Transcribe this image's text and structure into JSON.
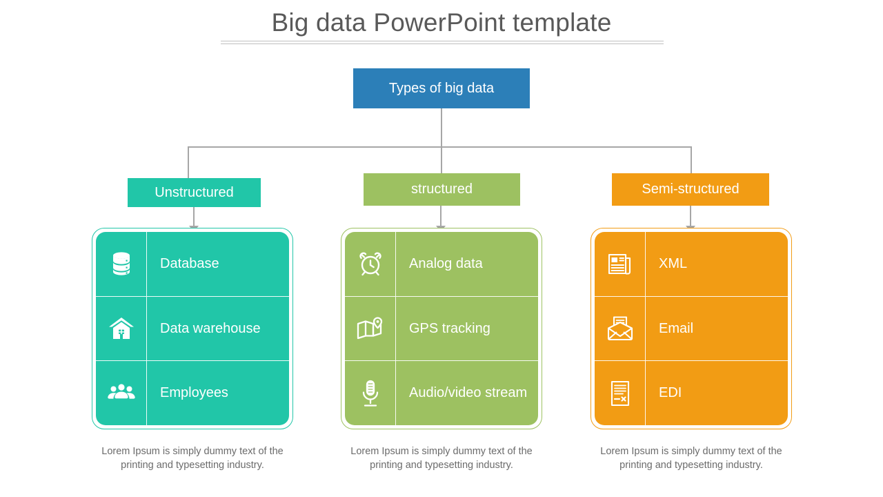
{
  "slide": {
    "title": "Big data PowerPoint template",
    "colors": {
      "blue": "#2C7FB8",
      "teal": "#21C6A8",
      "green": "#9DC161",
      "orange": "#F29C14",
      "title_text": "#595959",
      "connector": "#a6a6a6",
      "caption_text": "#6b6b6b"
    }
  },
  "root": {
    "label": "Types of big data"
  },
  "branches": [
    {
      "label": "Unstructured",
      "color": "#21C6A8",
      "items": [
        {
          "icon": "database-icon",
          "label": "Database"
        },
        {
          "icon": "warehouse-icon",
          "label": "Data warehouse"
        },
        {
          "icon": "employees-icon",
          "label": "Employees"
        }
      ],
      "caption": "Lorem Ipsum is simply dummy text of the printing and typesetting industry."
    },
    {
      "label": "structured",
      "color": "#9DC161",
      "items": [
        {
          "icon": "alarm-clock-icon",
          "label": "Analog data"
        },
        {
          "icon": "map-pin-icon",
          "label": "GPS tracking"
        },
        {
          "icon": "microphone-icon",
          "label": "Audio/video stream"
        }
      ],
      "caption": "Lorem Ipsum is simply dummy text of the printing and typesetting industry."
    },
    {
      "label": "Semi-structured",
      "color": "#F29C14",
      "items": [
        {
          "icon": "newspaper-icon",
          "label": "XML"
        },
        {
          "icon": "open-envelope-icon",
          "label": "Email"
        },
        {
          "icon": "document-x-icon",
          "label": "EDI"
        }
      ],
      "caption": "Lorem Ipsum is simply dummy text of the printing and typesetting industry."
    }
  ]
}
